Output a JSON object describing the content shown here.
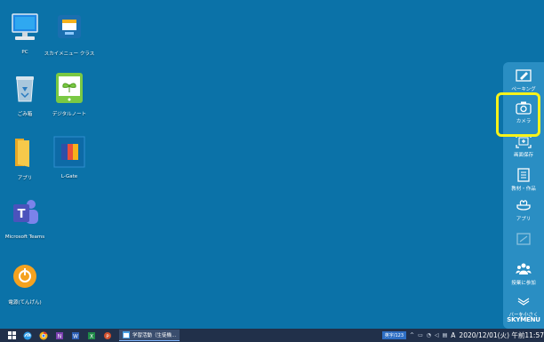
{
  "desktop": {
    "icons": [
      {
        "label": "PC",
        "icon": "pc-icon"
      },
      {
        "label": "スカイメニュー クラス",
        "icon": "skymenu-class-icon"
      },
      {
        "label": "ごみ箱",
        "icon": "recycle-bin-icon"
      },
      {
        "label": "デジタルノート",
        "icon": "digital-note-icon"
      },
      {
        "label": "アプリ",
        "icon": "folder-icon"
      },
      {
        "label": "L-Gate",
        "icon": "lgate-icon"
      },
      {
        "label": "Microsoft Teams",
        "icon": "teams-icon"
      },
      {
        "label": "電源(てんげん)",
        "icon": "power-icon"
      }
    ]
  },
  "toolbar": {
    "items": [
      {
        "label": "ペーキング",
        "icon": "pen-icon"
      },
      {
        "label": "カメラ",
        "icon": "camera-icon"
      },
      {
        "label": "画面保存",
        "icon": "screen-save-icon"
      },
      {
        "label": "教材・作品",
        "icon": "materials-icon"
      },
      {
        "label": "アプリ",
        "icon": "apps-icon"
      },
      {
        "label": "",
        "icon": "disabled-tool-icon"
      },
      {
        "label": "授業に参加",
        "icon": "join-class-icon"
      },
      {
        "label": "バーを小さく",
        "icon": "minimize-bar-icon"
      }
    ],
    "brand": "SKYMENU",
    "highlight_color": "#f6f31a",
    "background_color": "#2a8ec3"
  },
  "taskbar": {
    "pinned": [
      "windows-start-icon",
      "edge-icon",
      "chrome-icon",
      "onenote-icon",
      "word-icon",
      "excel-icon",
      "powerpoint-icon"
    ],
    "active_app": {
      "label": "学習活動（生徒機...",
      "icon": "app-window-icon"
    },
    "tray": {
      "ime_label": "英字/123",
      "input_mode": "A",
      "clock": "2020/12/01(火) 午前11:57"
    }
  }
}
